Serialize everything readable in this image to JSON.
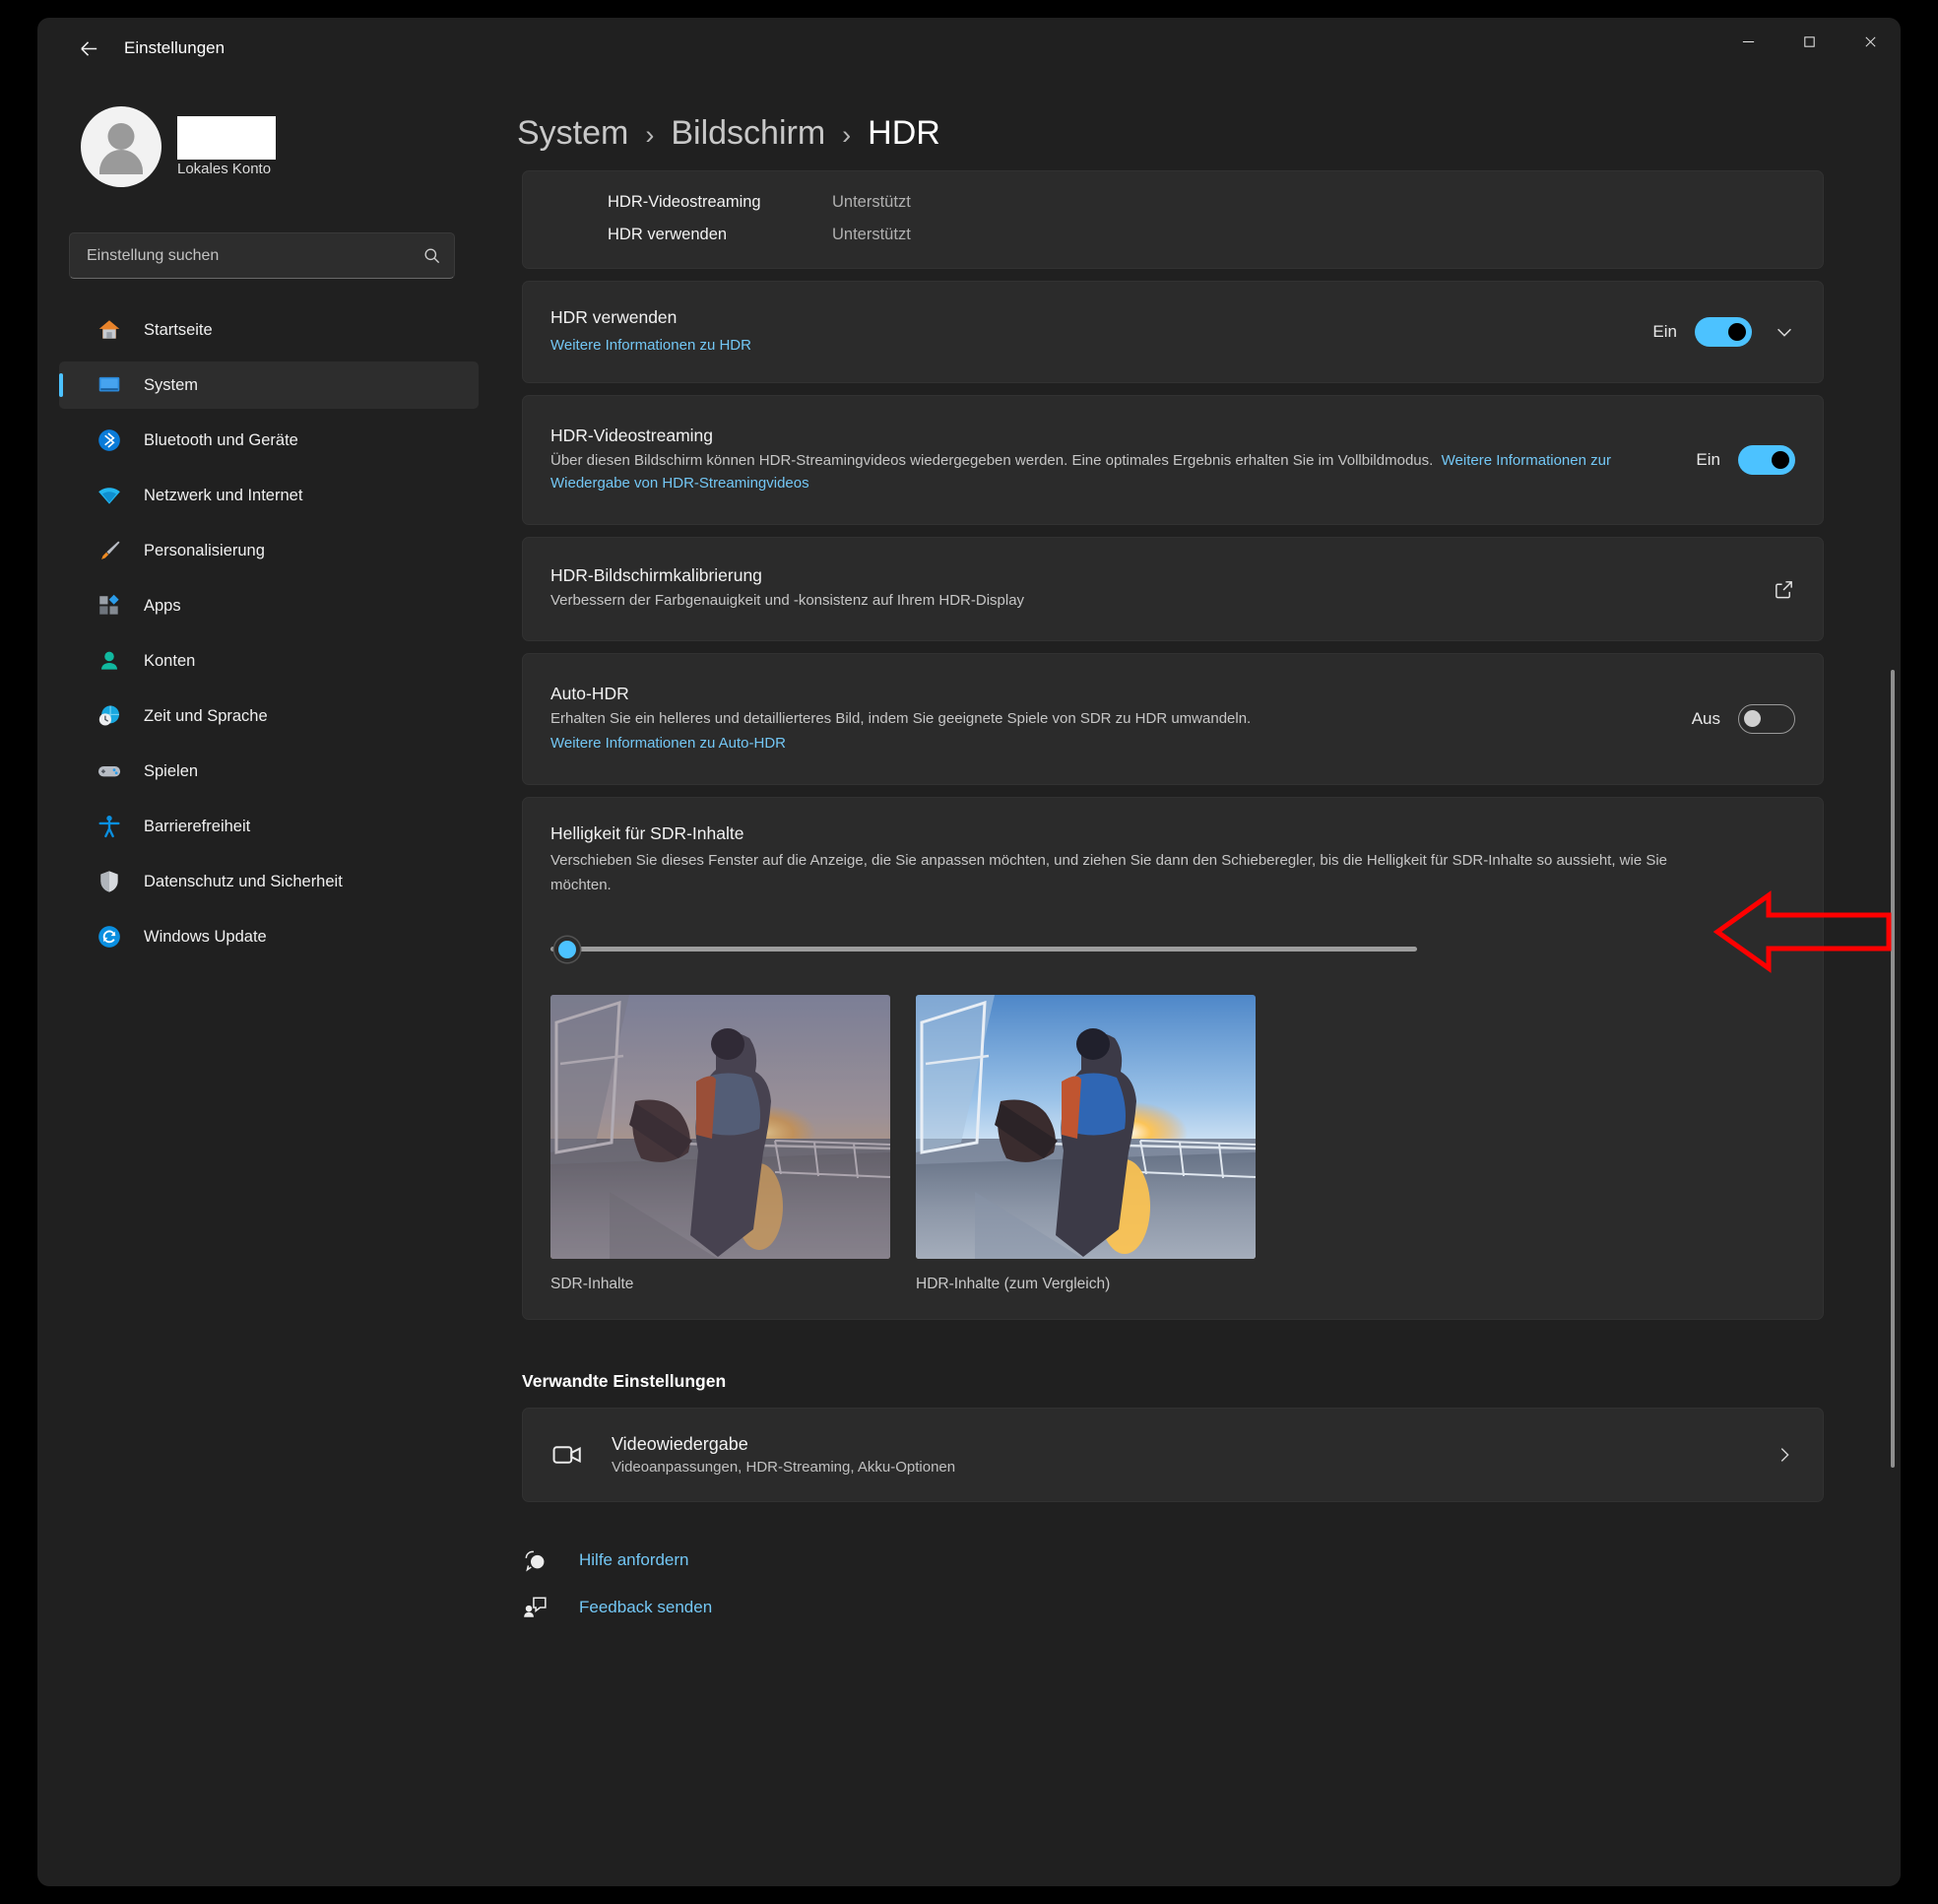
{
  "window": {
    "app_title": "Einstellungen",
    "back_icon": "back-arrow-icon",
    "controls": {
      "minimize": "minimize-icon",
      "maximize": "maximize-icon",
      "close": "close-icon"
    }
  },
  "sidebar": {
    "account": {
      "name_redacted": "",
      "subtitle": "Lokales Konto"
    },
    "search": {
      "placeholder": "Einstellung suchen",
      "value": "",
      "icon": "search-icon"
    },
    "items": [
      {
        "label": "Startseite",
        "icon": "home-icon",
        "selected": false
      },
      {
        "label": "System",
        "icon": "monitor-icon",
        "selected": true
      },
      {
        "label": "Bluetooth und Geräte",
        "icon": "bluetooth-icon",
        "selected": false
      },
      {
        "label": "Netzwerk und Internet",
        "icon": "wifi-icon",
        "selected": false
      },
      {
        "label": "Personalisierung",
        "icon": "paintbrush-icon",
        "selected": false
      },
      {
        "label": "Apps",
        "icon": "apps-icon",
        "selected": false
      },
      {
        "label": "Konten",
        "icon": "person-icon",
        "selected": false
      },
      {
        "label": "Zeit und Sprache",
        "icon": "clock-globe-icon",
        "selected": false
      },
      {
        "label": "Spielen",
        "icon": "gamepad-icon",
        "selected": false
      },
      {
        "label": "Barrierefreiheit",
        "icon": "accessibility-icon",
        "selected": false
      },
      {
        "label": "Datenschutz und Sicherheit",
        "icon": "shield-icon",
        "selected": false
      },
      {
        "label": "Windows Update",
        "icon": "update-icon",
        "selected": false
      }
    ]
  },
  "breadcrumb": [
    {
      "label": "System",
      "current": false
    },
    {
      "label": "Bildschirm",
      "current": false
    },
    {
      "label": "HDR",
      "current": true
    }
  ],
  "breadcrumb_separator": "›",
  "main": {
    "capabilities": {
      "rows": [
        {
          "key": "HDR-Videostreaming",
          "value": "Unterstützt"
        },
        {
          "key": "HDR verwenden",
          "value": "Unterstützt"
        }
      ]
    },
    "use_hdr": {
      "title": "HDR verwenden",
      "link": "Weitere Informationen zu HDR",
      "state": "Ein",
      "toggle_on": true,
      "expand_icon": "chevron-down-icon"
    },
    "hdr_video_streaming": {
      "title": "HDR-Videostreaming",
      "desc": "Über diesen Bildschirm können HDR-Streamingvideos wiedergegeben werden. Eine optimales Ergebnis erhalten Sie im Vollbildmodus.",
      "link": "Weitere Informationen zur Wiedergabe von HDR-Streamingvideos",
      "state": "Ein",
      "toggle_on": true
    },
    "display_calibration": {
      "title": "HDR-Bildschirmkalibrierung",
      "desc": "Verbessern der Farbgenauigkeit und -konsistenz auf Ihrem HDR-Display",
      "action_icon": "open-external-icon"
    },
    "auto_hdr": {
      "title": "Auto-HDR",
      "desc": "Erhalten Sie ein helleres und detaillierteres Bild, indem Sie geeignete Spiele von SDR zu HDR umwandeln.",
      "link": "Weitere Informationen zu Auto-HDR",
      "state": "Aus",
      "toggle_on": false
    },
    "sdr_brightness": {
      "title": "Helligkeit für SDR-Inhalte",
      "desc": "Verschieben Sie dieses Fenster auf die Anzeige, die Sie anpassen möchten, und ziehen Sie dann den Schieberegler, bis die Helligkeit für SDR-Inhalte so aussieht, wie Sie möchten.",
      "slider": {
        "value": 0,
        "min": 0,
        "max": 100
      },
      "previews": [
        {
          "label": "SDR-Inhalte",
          "kind": "sdr"
        },
        {
          "label": "HDR-Inhalte (zum Vergleich)",
          "kind": "hdr"
        }
      ]
    },
    "related": {
      "section_title": "Verwandte Einstellungen",
      "items": [
        {
          "title": "Videowiedergabe",
          "desc": "Videoanpassungen, HDR-Streaming, Akku-Optionen",
          "icon": "video-camera-icon",
          "chevron": "chevron-right-icon"
        }
      ]
    },
    "help_links": [
      {
        "label": "Hilfe anfordern",
        "icon": "help-icon"
      },
      {
        "label": "Feedback senden",
        "icon": "feedback-icon"
      }
    ]
  },
  "annotations": {
    "red_arrow": "red-left-arrow-annotation"
  },
  "colors": {
    "accent": "#4cc2ff",
    "link": "#73c7f5",
    "window_bg": "#202020",
    "card_bg": "#2b2b2b",
    "annotation_red": "#ff0000"
  }
}
